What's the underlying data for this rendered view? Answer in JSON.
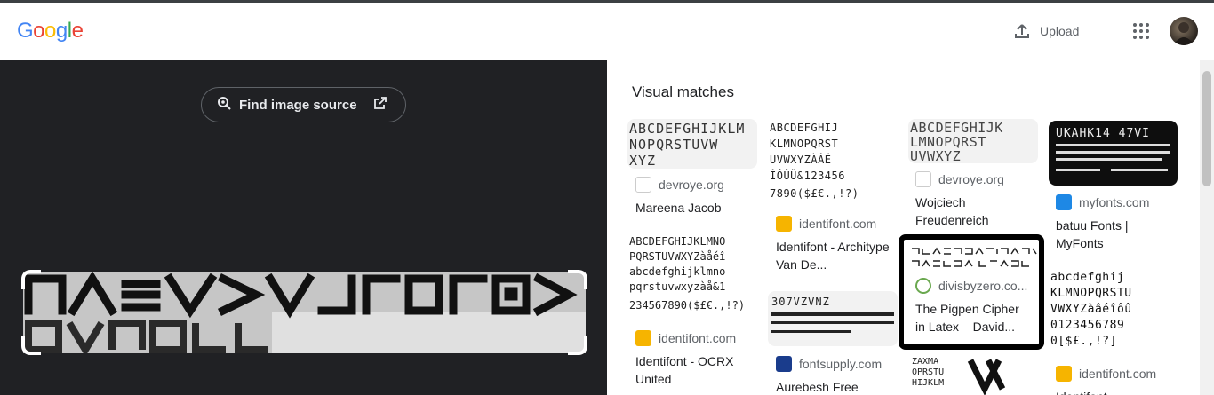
{
  "header": {
    "logo": "Google",
    "upload_label": "Upload",
    "apps_icon": "apps-grid-icon",
    "avatar": "user-avatar"
  },
  "lens": {
    "find_source_label": "Find image source",
    "crop_text_line1": "ΠΛΕV>VJ⌐OΓO▫>Π",
    "crop_text_line2": "OVΠOLL"
  },
  "visual_matches": {
    "title": "Visual matches",
    "items": [
      {
        "source": "devroye.org",
        "title": "Mareena Jacob",
        "thumb_text": "ABCDEFGHIJKLM NOPQRSTUVW XYZ"
      },
      {
        "source": "identifont.com",
        "title": "Identifont - Architype Van De...",
        "thumb_text": "ABCDEFGHIJ KLMNOPQRST UVWXYZÀÂÉ ÎÔÛÜ&123456 7890($£€.,!?)"
      },
      {
        "source": "devroye.org",
        "title": "Wojciech Freudenreich",
        "thumb_text": "ABCDEFGHIJK LMNOPQRST UVWXYZ"
      },
      {
        "source": "myfonts.com",
        "title": "batuu Fonts | MyFonts",
        "thumb_text": "UKAHK14 47VI"
      },
      {
        "source": "identifont.com",
        "title": "Identifont - OCRX United",
        "thumb_text": "ABCDEFGHIJKLMNO PQRSTUVWXYZàåéî abcdefghijklmno pqrstuvwxyzàå&1 234567890($£€.,!?)"
      },
      {
        "source": "fontsupply.com",
        "title": "Aurebesh Free",
        "thumb_text": "307VZVNZ"
      },
      {
        "source": "divisbyzero.co...",
        "title": "The Pigpen Cipher in Latex – David...",
        "thumb_text": "ᒣᒧᐱᑐ ᒥᒪᒉᑎᐯᒣᑭ ᒣᐱ ᐅᐸᒪᐱᒥᑐ ᒪᐱ ᐱᐅᑭᒣ"
      },
      {
        "source": "identifont.com",
        "title": "Identifont - ...",
        "thumb_text": "abcdefghij KLMNOPQRSTU VWXYZàâéîôû 0123456789 0[$£.,!?]"
      },
      {
        "source": "",
        "title": "",
        "thumb_text": "ZAXMA OPRSTU HIJKLM"
      }
    ]
  },
  "colors": {
    "google_blue": "#4285F4",
    "google_red": "#EA4335",
    "google_yellow": "#FBBC05",
    "google_green": "#34A853",
    "dark_panel": "#202124"
  }
}
